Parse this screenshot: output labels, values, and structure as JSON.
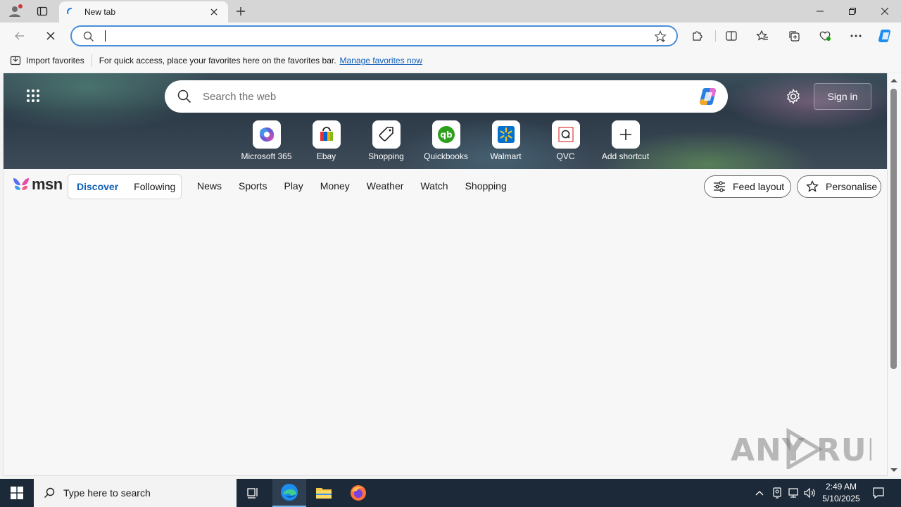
{
  "browser": {
    "tab_title": "New tab",
    "address_value": "",
    "favorites_bar": {
      "import_label": "Import favorites",
      "message": "For quick access, place your favorites here on the favorites bar.",
      "manage_link": "Manage favorites now"
    }
  },
  "newtab": {
    "search_placeholder": "Search the web",
    "signin_label": "Sign in",
    "shortcuts": [
      {
        "label": "Microsoft 365",
        "icon": "microsoft-365-icon"
      },
      {
        "label": "Ebay",
        "icon": "ebay-icon"
      },
      {
        "label": "Shopping",
        "icon": "shopping-tag-icon"
      },
      {
        "label": "Quickbooks",
        "icon": "quickbooks-icon"
      },
      {
        "label": "Walmart",
        "icon": "walmart-icon"
      },
      {
        "label": "QVC",
        "icon": "qvc-icon"
      },
      {
        "label": "Add shortcut",
        "icon": "plus-icon"
      }
    ],
    "msn": {
      "logo_text": "msn",
      "segments": [
        "Discover",
        "Following"
      ],
      "nav": [
        "News",
        "Sports",
        "Play",
        "Money",
        "Weather",
        "Watch",
        "Shopping"
      ],
      "feed_layout_label": "Feed layout",
      "personalise_label": "Personalise"
    }
  },
  "watermark": "ANY RUN",
  "taskbar": {
    "search_placeholder": "Type here to search",
    "time": "2:49 AM",
    "date": "5/10/2025"
  },
  "colors": {
    "accent": "#0f5eb8",
    "address_border": "#4a8fd8",
    "taskbar": "#1c2938"
  }
}
